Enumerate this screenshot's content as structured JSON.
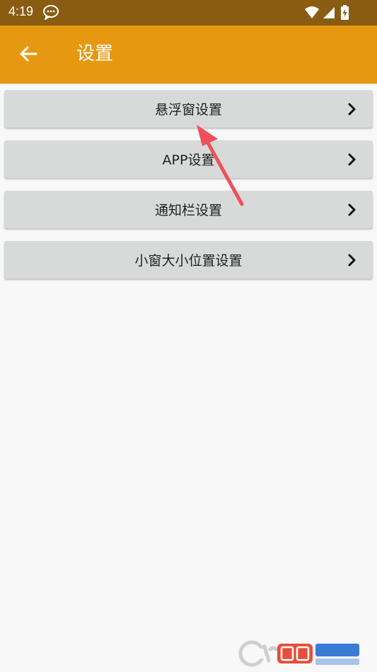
{
  "status_bar": {
    "time": "4:19",
    "icons": [
      "message-bubble-icon",
      "wifi-icon",
      "signal-icon",
      "battery-charging-icon"
    ],
    "background": "#8a5c12"
  },
  "app_bar": {
    "title": "设置",
    "back_icon": "arrow-left-icon",
    "background": "#e69910"
  },
  "menu": {
    "items": [
      {
        "label": "悬浮窗设置",
        "icon": "chevron-right-icon"
      },
      {
        "label": "APP设置",
        "icon": "chevron-right-icon"
      },
      {
        "label": "通知栏设置",
        "icon": "chevron-right-icon"
      },
      {
        "label": "小窗大小位置设置",
        "icon": "chevron-right-icon"
      }
    ],
    "item_background": "#d8d9d9"
  },
  "annotation": {
    "color": "#f0505a",
    "icon": "red-arrow-annotation"
  },
  "watermark": {
    "icon": "site-logo-watermark"
  }
}
